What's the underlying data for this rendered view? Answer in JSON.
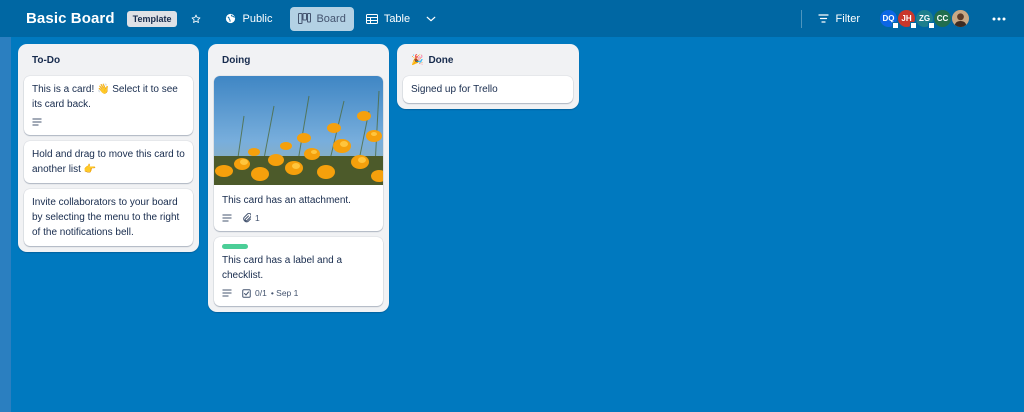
{
  "header": {
    "board_title": "Basic Board",
    "template_badge": "Template",
    "visibility": "Public",
    "view_board": "Board",
    "view_table": "Table",
    "filter": "Filter",
    "members": [
      {
        "initials": "DQ",
        "color": "#0c66e4"
      },
      {
        "initials": "JH",
        "color": "#c9372c"
      },
      {
        "initials": "ZG",
        "color": "#1d7f8c"
      },
      {
        "initials": "CC",
        "color": "#216e4e"
      },
      {
        "initials": "",
        "color": "#8c5a3b"
      }
    ]
  },
  "lists": [
    {
      "title": "To-Do",
      "cards": [
        {
          "text": "This is a card! 👋 Select it to see its card back.",
          "has_description": true
        },
        {
          "text": "Hold and drag to move this card to another list 👉"
        },
        {
          "text": "Invite collaborators to your board by selecting the menu to the right of the notifications bell."
        }
      ]
    },
    {
      "title": "Doing",
      "cards": [
        {
          "text": "This card has an attachment.",
          "has_description": true,
          "attachments": "1",
          "cover": "orange-poppies"
        },
        {
          "text": "This card has a label and a checklist.",
          "has_description": true,
          "label_color": "#4bce97",
          "checklist": "0/1",
          "due": "• Sep 1"
        }
      ]
    },
    {
      "title": "Done",
      "emoji": "🎉",
      "cards": [
        {
          "text": "Signed up for Trello"
        }
      ]
    }
  ]
}
